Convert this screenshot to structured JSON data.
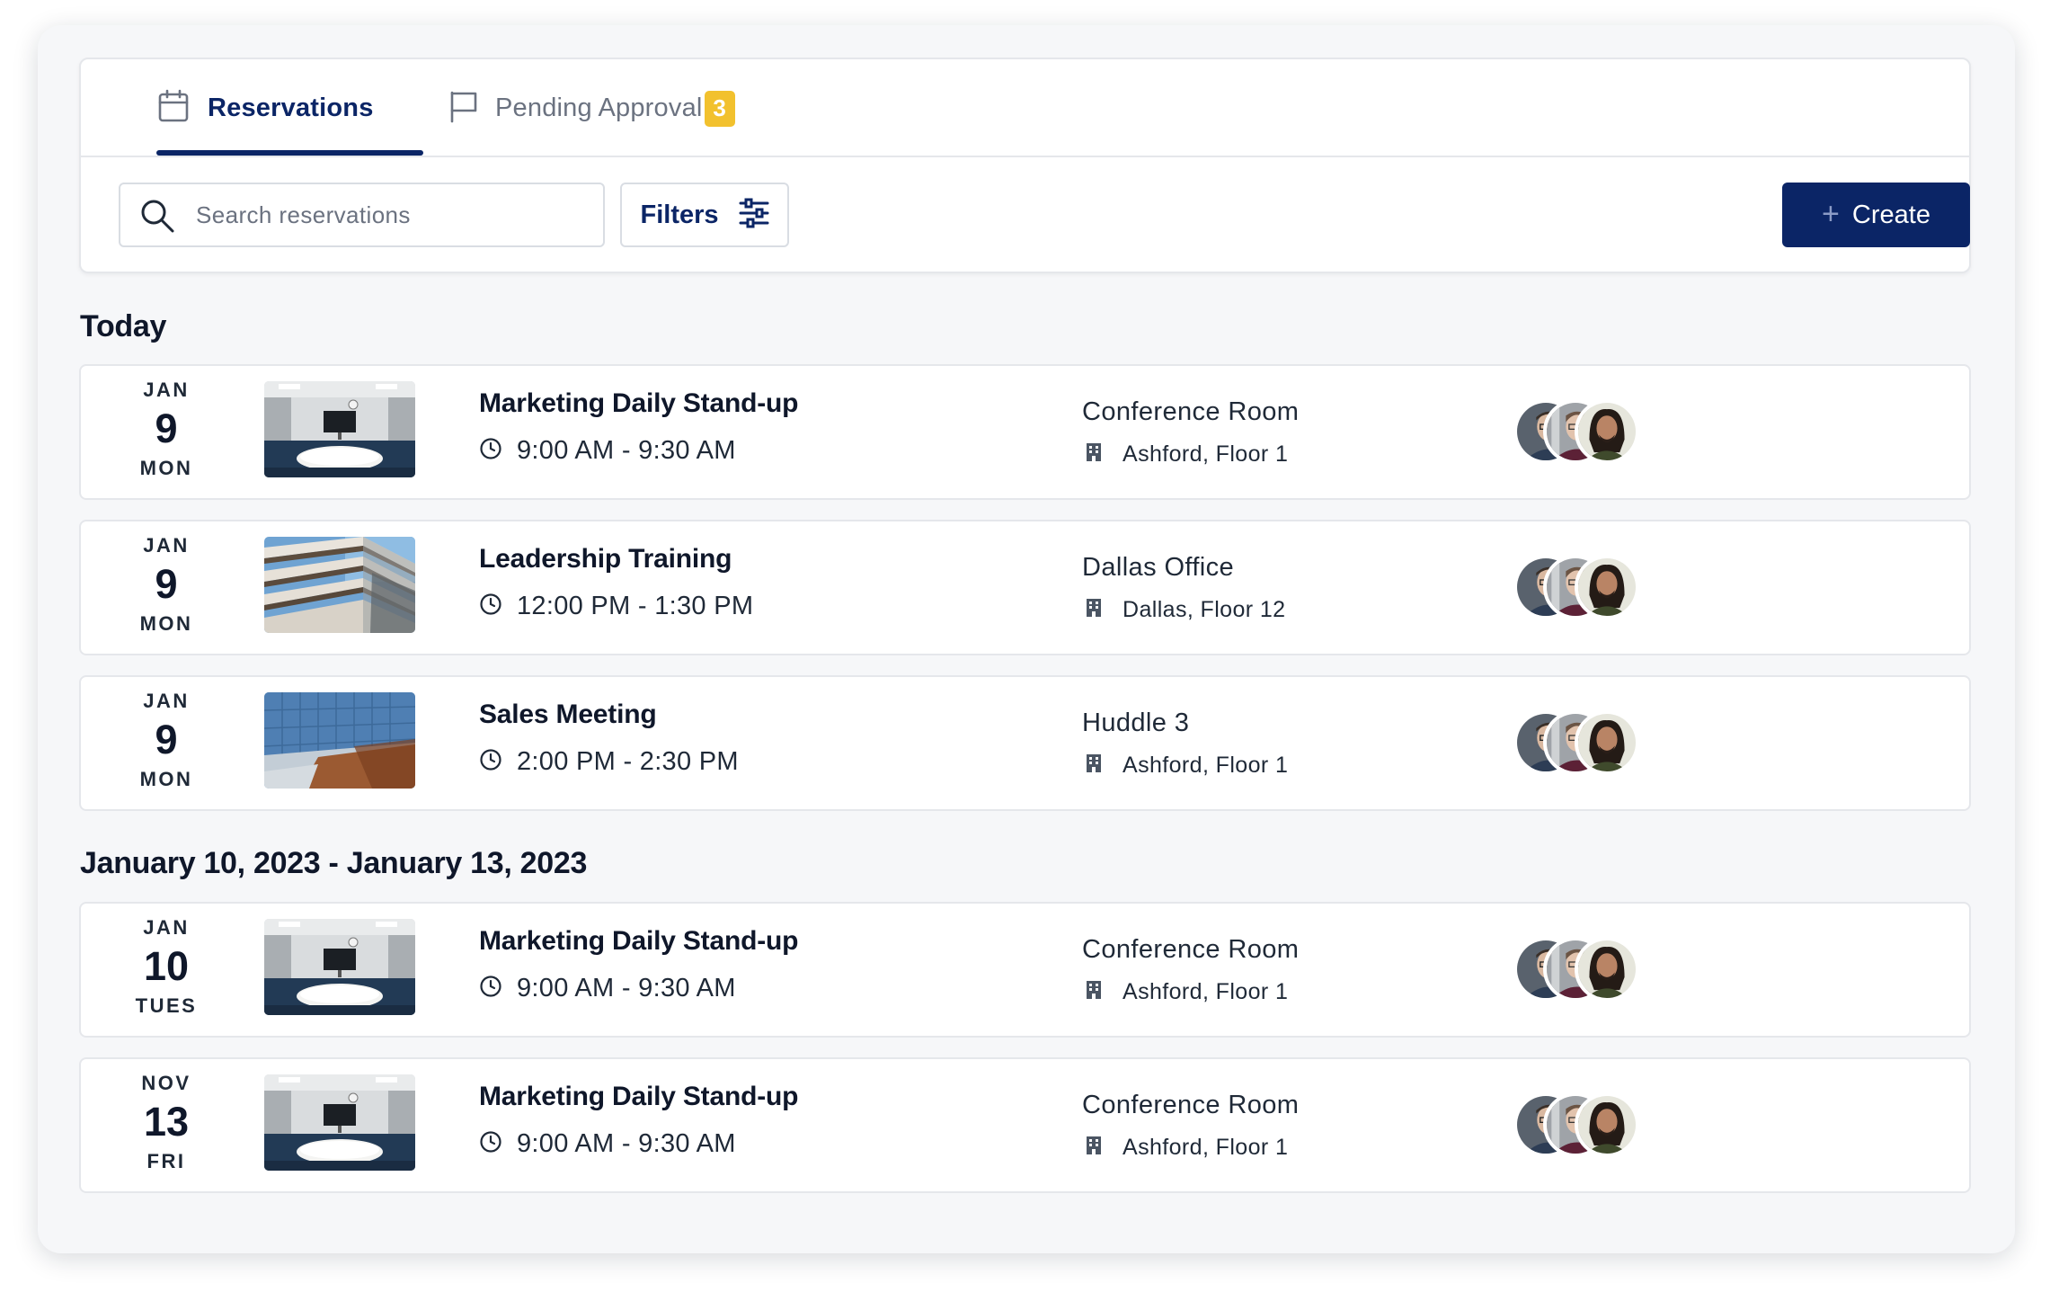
{
  "tabs": [
    {
      "label": "Reservations",
      "icon": "calendar-icon",
      "active": true
    },
    {
      "label": "Pending Approval",
      "icon": "flag-icon",
      "badge": "3",
      "active": false
    }
  ],
  "toolbar": {
    "search_placeholder": "Search reservations",
    "filters_label": "Filters",
    "create_label": "Create"
  },
  "sections": [
    {
      "title": "Today"
    },
    {
      "title": "January 10, 2023 - January 13, 2023"
    }
  ],
  "reservations": [
    {
      "month": "JAN",
      "day": "9",
      "weekday": "MON",
      "title": "Marketing Daily Stand-up",
      "time": "9:00 AM - 9:30 AM",
      "room": "Conference Room",
      "location": "Ashford, Floor 1",
      "image": "conference-room"
    },
    {
      "month": "JAN",
      "day": "9",
      "weekday": "MON",
      "title": "Leadership Training",
      "time": "12:00 PM - 1:30 PM",
      "room": "Dallas Office",
      "location": "Dallas, Floor 12",
      "image": "building-balconies"
    },
    {
      "month": "JAN",
      "day": "9",
      "weekday": "MON",
      "title": "Sales Meeting",
      "time": "2:00 PM - 2:30 PM",
      "room": "Huddle 3",
      "location": "Ashford, Floor 1",
      "image": "glass-tower"
    },
    {
      "month": "JAN",
      "day": "10",
      "weekday": "TUES",
      "title": "Marketing Daily Stand-up",
      "time": "9:00 AM - 9:30 AM",
      "room": "Conference Room",
      "location": "Ashford, Floor 1",
      "image": "conference-room"
    },
    {
      "month": "NOV",
      "day": "13",
      "weekday": "FRI",
      "title": "Marketing Daily Stand-up",
      "time": "9:00 AM - 9:30 AM",
      "room": "Conference Room",
      "location": "Ashford, Floor 1",
      "image": "conference-room"
    }
  ],
  "colors": {
    "primary": "#0b2566",
    "badge": "#f2c12e",
    "background": "#f6f7f9",
    "border": "#e5e7eb"
  }
}
